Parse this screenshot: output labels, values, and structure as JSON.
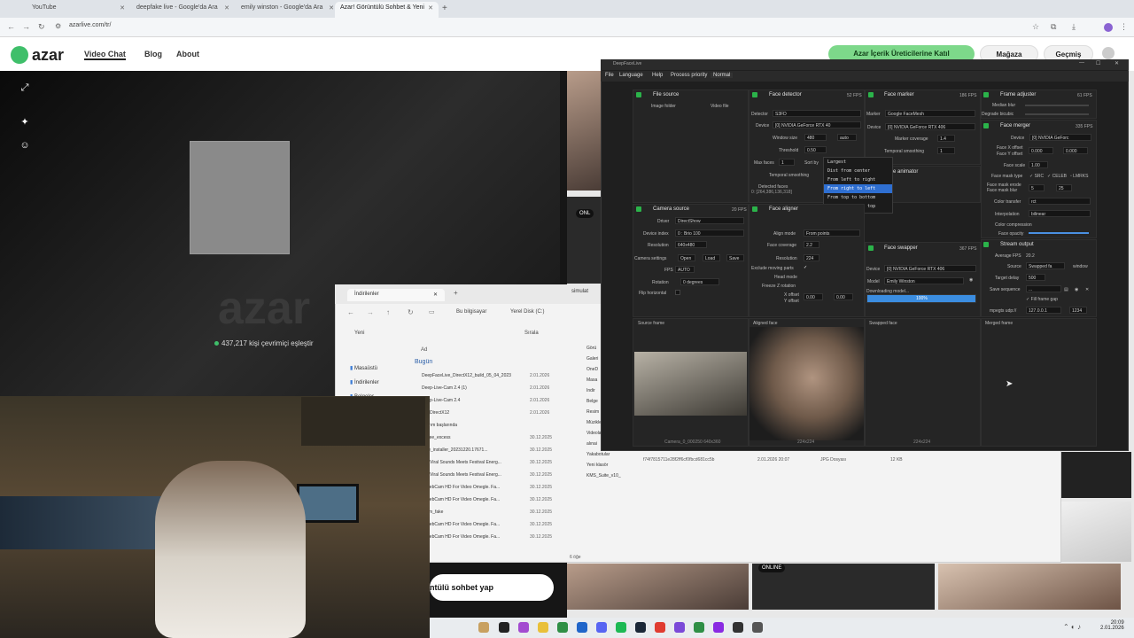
{
  "browser": {
    "tabs": [
      {
        "title": "YouTube"
      },
      {
        "title": "deepfake live - Google'da Ara"
      },
      {
        "title": "emily winston - Google'da Ara"
      },
      {
        "title": "Azar! Görüntülü Sohbet & Yeni"
      }
    ],
    "url": "azarlive.com/tr/"
  },
  "site": {
    "logo": "azar",
    "nav": [
      "Video Chat",
      "Blog",
      "About"
    ],
    "promo_button": "Azar İçerik Üreticilerine Katıl",
    "shop_button": "Mağaza",
    "history_button": "Geçmiş",
    "watermark": "azar",
    "online_count": "437,217 kişi çevrimiçi eşleştir",
    "cta": "ntülü sohbet yap",
    "online_badge": "ONLINE",
    "online_badge_short": "ONL"
  },
  "explorer": {
    "tab_title": "İndirilenler",
    "tab_title_2": "simulat",
    "breadcrumb": [
      "Bu bilgisayar",
      "Yerel Disk (C:)"
    ],
    "new_label": "Yeni",
    "sort_label": "Sırala",
    "col_name": "Ad",
    "group_today": "Bugün",
    "sidebar": [
      "Masaüstü",
      "İndirilenler",
      "Belgeler"
    ],
    "sidebar_right": [
      "Görü",
      "Galeri",
      "OneD",
      "Masa",
      "İndir",
      "Belge",
      "Resim",
      "Müzikler",
      "Videolar",
      "alınai",
      "Yakabotular",
      "Yeni klasör",
      "KMS_Suite_v10_"
    ],
    "files": [
      {
        "name": "DeepFaceLive_DirectX12_build_05_04_2023",
        "date": "2.01.2026"
      },
      {
        "name": "Deep-Live-Cam 2.4 (1)",
        "date": "2.01.2026"
      },
      {
        "name": "Deep-Live-Cam 2.4",
        "date": "2.01.2026"
      },
      {
        "name": "ive_DirectX12",
        "date": "2.01.2026"
      },
      {
        "name": "aştırım başlarında",
        "date": ""
      },
      {
        "name": "e_free_excess",
        "date": "30.12.2025"
      },
      {
        "name": "ivive_installer_20231220.17671...",
        "date": "30.12.2025"
      },
      {
        "name": "Tok Viral Sounds Meets Festival Energ...",
        "date": "30.12.2025"
      },
      {
        "name": "Tok Viral Sounds Meets Festival Energ...",
        "date": "30.12.2025"
      },
      {
        "name": "e WebCam HD For Video Omegle. Fa...",
        "date": "30.12.2025"
      },
      {
        "name": "e WebCam HD For Video Omegle. Fa...",
        "date": "30.12.2025"
      },
      {
        "name": "bcam_fake",
        "date": "30.12.2025"
      },
      {
        "name": "e WebCam HD For Video Omegle. Fa...",
        "date": "30.12.2025"
      },
      {
        "name": "e WebCam HD For Video Omegle. Fa...",
        "date": "30.12.2025"
      }
    ],
    "bottom_file": {
      "name": "f74f7815711e28f2ff6cf0fbcd681cc5b",
      "date": "2.01.2026 20:07",
      "type": "JPG Dosyası",
      "size": "12 KB"
    },
    "status": "6 öğe"
  },
  "dfl": {
    "window_title": "DeepFaceLive",
    "menu": [
      "File",
      "Language",
      "Help",
      "Process priority",
      "Normal"
    ],
    "file_source": {
      "title": "File source",
      "image_folder": "Image folder",
      "video_file": "Video file"
    },
    "face_detector": {
      "title": "Face detector",
      "fps": "52 FPS",
      "detector_label": "Detector",
      "detector": "S3FD",
      "device_label": "Device",
      "device": "[0] NVIDIA GeForce RTX 40",
      "window_size_label": "Window size",
      "window_size": "480",
      "auto": "auto",
      "threshold_label": "Threshold",
      "threshold": "0.50",
      "max_faces_label": "Max faces",
      "max_faces": "1",
      "sort_by": "Sort by",
      "temporal_smoothing": "Temporal smoothing",
      "detected_faces": "Detected faces",
      "detected_value": "0: [264,386,136,318]"
    },
    "sort_options": [
      "Largest",
      "Dist from center",
      "From left to right",
      "From right to left",
      "From top to bottom",
      "From bottom to top"
    ],
    "sort_selected": 3,
    "face_marker": {
      "title": "Face marker",
      "fps": "186 FPS",
      "marker_label": "Marker",
      "marker": "Google FaceMesh",
      "device_label": "Device",
      "device": "[0] NVIDIA GeForce RTX 406",
      "coverage_label": "Marker coverage",
      "coverage": "1.4",
      "smoothing_label": "Temporal smoothing",
      "smoothing": "1"
    },
    "animator": "e animator",
    "frame_adjuster": {
      "title": "Frame adjuster",
      "fps": "61 FPS",
      "median_blur": "Median blur",
      "degrade": "Degrade bicubic"
    },
    "face_merger": {
      "title": "Face merger",
      "fps": "335 FPS",
      "device_label": "Device",
      "device": "[0] NVIDIA GeForc",
      "x_offset_label": "Face X offset",
      "x_offset": "0.000",
      "y_offset_label": "Face Y offset",
      "y_offset": "0.000",
      "scale_label": "Face scale",
      "scale": "1.00",
      "mask_type_label": "Face mask type",
      "mask_src": "SRC",
      "mask_celeb": "CELEB",
      "mask_lmrks": "LMRKS",
      "erode_label": "Face mask erode",
      "erode": "5",
      "blur_label": "Face mask blur",
      "blur": "25",
      "color_transfer_label": "Color transfer",
      "color_transfer": "rct",
      "interp_label": "Interpolation",
      "interp": "bilinear",
      "compression_label": "Color compression",
      "opacity_label": "Face opacity"
    },
    "camera_source": {
      "title": "Camera source",
      "fps": "20 FPS",
      "driver_label": "Driver",
      "driver": "DirectShow",
      "index_label": "Device index",
      "index": "0 : Brio 100",
      "res_label": "Resolution",
      "res": "640x480",
      "settings_label": "Camera settings",
      "open": "Open",
      "load": "Load",
      "save": "Save",
      "fps_label": "FPS",
      "fps_val": "AUTO",
      "rot_label": "Rotation",
      "rot": "0 degrees",
      "flip": "Flip horizontal"
    },
    "face_aligner": {
      "title": "Face aligner",
      "align_label": "Align mode",
      "align": "From points",
      "coverage_label": "Face coverage",
      "coverage": "2.2",
      "res_label": "Resolution",
      "res": "224",
      "exclude": "Exclude moving parts",
      "head_mode": "Head mode",
      "freeze_z": "Freeze Z rotation",
      "x_off": "X offset",
      "y_off": "Y offset",
      "x_val": "0.00",
      "y_val": "0.00"
    },
    "face_swapper": {
      "title": "Face swapper",
      "fps": "367 FPS",
      "device_label": "Device",
      "device": "[0] NVIDIA GeForce RTX 406",
      "model_label": "Model",
      "model": "Emily Winston",
      "downloading": "Downloading model...",
      "progress": "100%",
      "progress_value": 1.0
    },
    "stream_output": {
      "title": "Stream output",
      "avg_fps_label": "Average FPS",
      "avg_fps": "20.2",
      "source_label": "Source",
      "source": "Swapped fa",
      "window": "window",
      "delay_label": "Target delay",
      "delay": "500",
      "seq_label": "Save sequence",
      "seq": "...",
      "fill_gap": "Fill frame gap",
      "mpegts_label": "mpegts udp://",
      "mpegts_ip": "127.0.0.1",
      "mpegts_port": "1234"
    },
    "viewers": {
      "source": "Source frame",
      "aligned": "Aligned face",
      "swapped": "Swapped face",
      "merged": "Merged frame",
      "source_caption": "Camera_0_000250 640x360",
      "aligned_caption": "224x224",
      "swapped_caption": "224x224"
    }
  },
  "taskbar": {
    "time": "20:09",
    "date": "2.01.2026"
  }
}
